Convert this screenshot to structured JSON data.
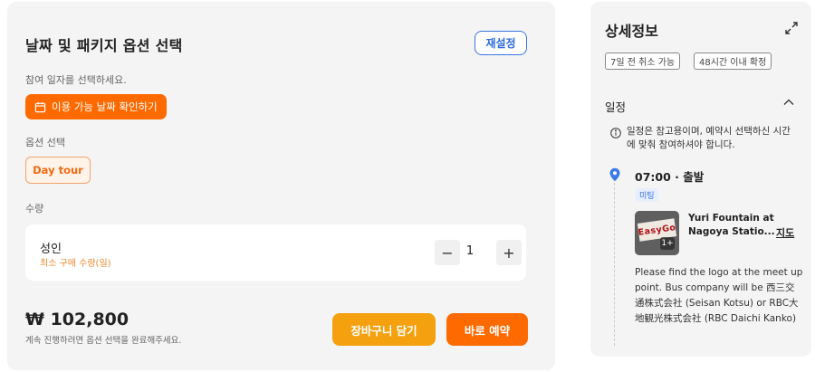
{
  "booking": {
    "title": "날짜 및 패키지 옵션 선택",
    "reset_label": "재설정",
    "date_prompt": "참여 일자를 선택하세요.",
    "date_button_label": "이용 가능 날짜 확인하기",
    "option_label": "옵션 선택",
    "option_selected": "Day tour",
    "quantity_label": "수량",
    "quantity": {
      "type_name": "성인",
      "min_note": "최소 구매 수량(일)",
      "value": "1",
      "minus": "−",
      "plus": "+"
    },
    "price": "₩ 102,800",
    "price_note": "계속 진행하려면 옵션 선택을 완료해주세요.",
    "cart_label": "장바구니 담기",
    "book_label": "바로 예약"
  },
  "details": {
    "title": "상세정보",
    "tags": [
      "7일 전 취소 가능",
      "48시간 이내 확정"
    ],
    "itinerary_title": "일정",
    "notice": "일정은 참고용이며, 예약시 선택하신 시간에 맞춰 참여하셔야 합니다.",
    "stop": {
      "time": "07:00 · 출발",
      "badge": "미팅",
      "thumb_text": "EasyGo",
      "thumb_badge": "1+",
      "place": "Yuri Fountain at Nagoya Statio...",
      "map_link": "지도",
      "description": "Please find the logo at the meet up point. Bus company will be 西三交通株式会社 (Seisan Kotsu) or RBC大地観光株式会社 (RBC Daichi Kanko)"
    }
  },
  "colors": {
    "accent_orange": "#ff6a00",
    "cart_orange": "#f5a00f",
    "link_blue": "#2f6be0"
  },
  "icons": [
    "calendar-icon",
    "expand-icon",
    "chevron-up-icon",
    "info-icon",
    "location-pin-icon"
  ]
}
